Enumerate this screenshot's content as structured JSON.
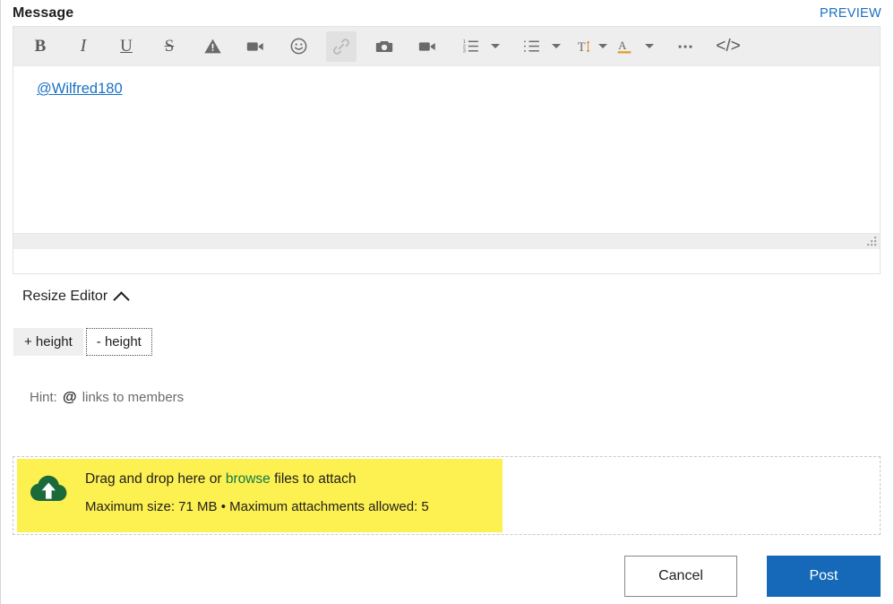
{
  "header": {
    "title": "Message",
    "preview_label": "PREVIEW"
  },
  "toolbar": {
    "items": [
      {
        "name": "bold-icon",
        "label": "B",
        "glyph": "B"
      },
      {
        "name": "italic-icon",
        "label": "I",
        "glyph": "I"
      },
      {
        "name": "underline-icon",
        "label": "U",
        "glyph": "U"
      },
      {
        "name": "strikethrough-icon",
        "label": "S",
        "glyph": "S"
      },
      {
        "name": "spoiler-warning-icon",
        "label": "Spoiler"
      },
      {
        "name": "video-icon",
        "label": "Insert video"
      },
      {
        "name": "emoji-icon",
        "label": "Insert emoji"
      },
      {
        "name": "link-icon",
        "label": "Insert link"
      },
      {
        "name": "camera-icon",
        "label": "Insert image"
      },
      {
        "name": "video-camera-icon",
        "label": "Insert media"
      },
      {
        "name": "numbered-list-icon",
        "label": "Numbered list"
      },
      {
        "name": "numbered-list-caret-icon",
        "label": "Numbered list options"
      },
      {
        "name": "bullet-list-icon",
        "label": "Bulleted list"
      },
      {
        "name": "bullet-list-caret-icon",
        "label": "Bulleted list options"
      },
      {
        "name": "text-size-icon",
        "label": "Text size"
      },
      {
        "name": "font-color-icon",
        "label": "Font color"
      },
      {
        "name": "font-color-caret-icon",
        "label": "Font color options"
      },
      {
        "name": "more-options-icon",
        "label": "More options"
      },
      {
        "name": "code-view-icon",
        "label": "Source code"
      }
    ]
  },
  "editor": {
    "content_mention": "@Wilfred180"
  },
  "resize": {
    "label": "Resize Editor",
    "increase_label": "+ height",
    "decrease_label": "- height"
  },
  "hint": {
    "prefix": "Hint:",
    "symbol": "@",
    "text": "links to members"
  },
  "dropzone": {
    "line1_before": "Drag and drop here or",
    "browse_label": "browse",
    "line1_after": "files to attach",
    "line2": "Maximum size: 71 MB • Maximum attachments allowed: 5"
  },
  "footer": {
    "cancel_label": "Cancel",
    "post_label": "Post"
  },
  "colors": {
    "accent_blue": "#1668b8",
    "link_blue": "#1b72c2",
    "browse_green": "#11794b",
    "cloud_green": "#1b6b3a",
    "highlight_yellow": "#fdf051",
    "toolbar_bg": "#efeeee"
  }
}
